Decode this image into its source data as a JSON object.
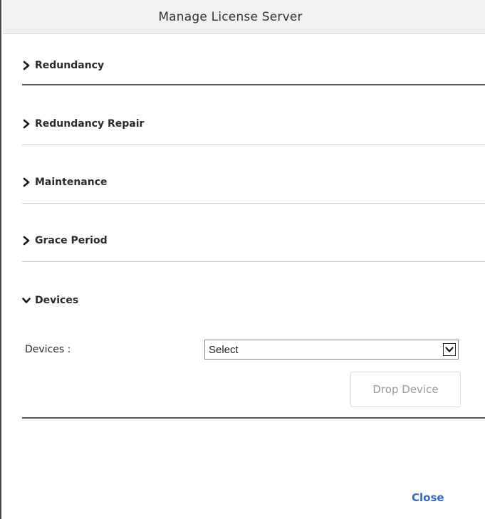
{
  "dialog": {
    "title": "Manage License Server",
    "close_label": "Close"
  },
  "sections": [
    {
      "label": "Redundancy",
      "expanded": false
    },
    {
      "label": "Redundancy Repair",
      "expanded": false
    },
    {
      "label": "Maintenance",
      "expanded": false
    },
    {
      "label": "Grace Period",
      "expanded": false
    },
    {
      "label": "Devices",
      "expanded": true
    }
  ],
  "devices_panel": {
    "field_label": "Devices :",
    "select_value": "Select",
    "drop_button_label": "Drop Device"
  },
  "colors": {
    "link": "#3366cc",
    "disabled_text": "#9a9a9a",
    "titlebar_bg": "#f1f1f1"
  }
}
